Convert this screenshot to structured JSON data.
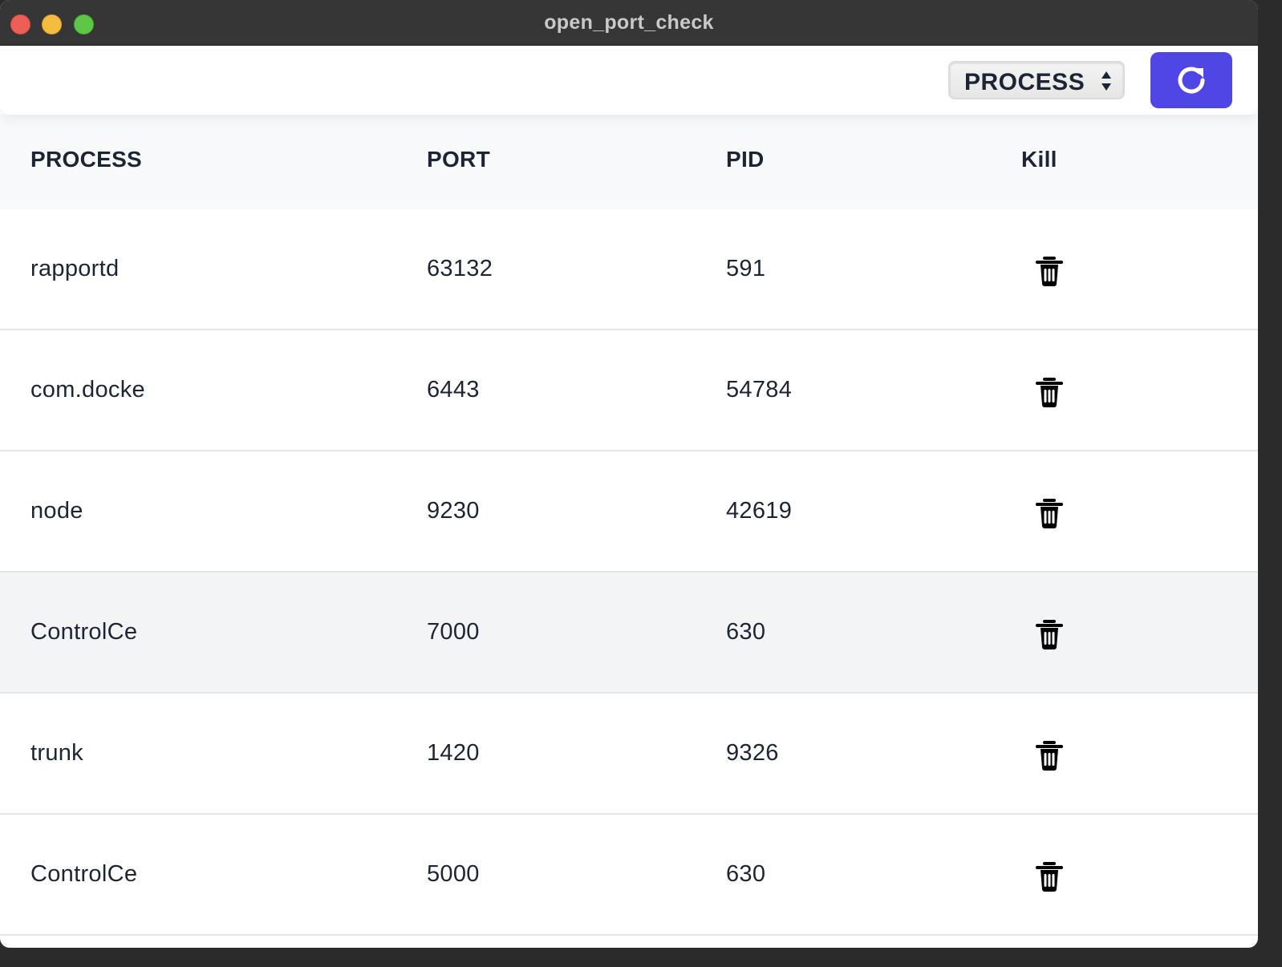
{
  "window": {
    "title": "open_port_check"
  },
  "toolbar": {
    "sort_select_value": "PROCESS",
    "refresh_icon": "refresh-icon",
    "accent_color": "#4f46e5"
  },
  "table": {
    "headers": {
      "process": "PROCESS",
      "port": "PORT",
      "pid": "PID",
      "kill": "Kill"
    },
    "rows": [
      {
        "process": "rapportd",
        "port": "63132",
        "pid": "591"
      },
      {
        "process": "com.docke",
        "port": "6443",
        "pid": "54784"
      },
      {
        "process": "node",
        "port": "9230",
        "pid": "42619"
      },
      {
        "process": "ControlCe",
        "port": "7000",
        "pid": "630"
      },
      {
        "process": "trunk",
        "port": "1420",
        "pid": "9326"
      },
      {
        "process": "ControlCe",
        "port": "5000",
        "pid": "630"
      }
    ],
    "kill_icon": "trash-icon",
    "highlighted_row": 3
  }
}
